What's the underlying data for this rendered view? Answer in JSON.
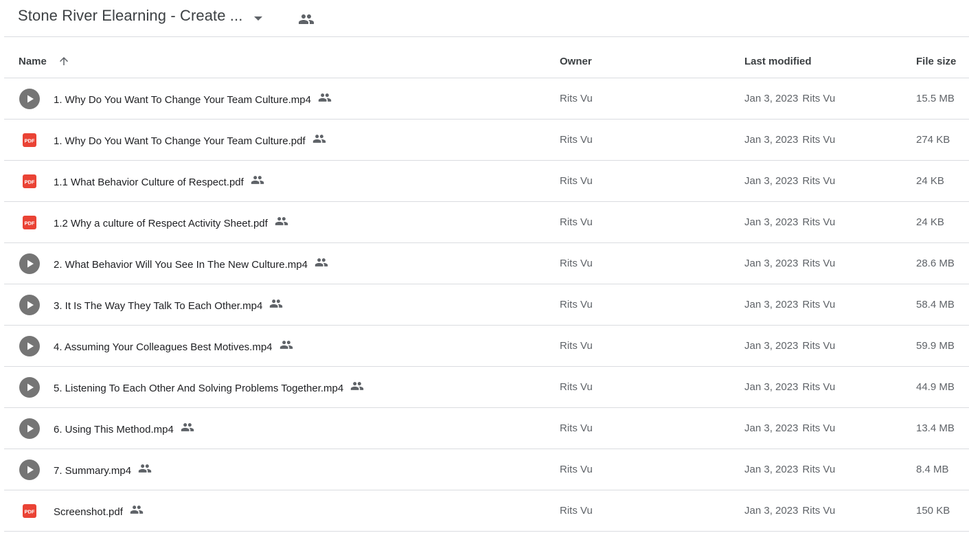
{
  "header": {
    "folder_title": "Stone River Elearning - Create ...",
    "caret_icon": "arrow-drop-down-icon",
    "shared_icon": "people-icon"
  },
  "columns": {
    "name": "Name",
    "owner": "Owner",
    "last_modified": "Last modified",
    "file_size": "File size",
    "sort_icon": "arrow-upward-icon"
  },
  "colors": {
    "pdf_red": "#ea4335",
    "video_gray": "#757575",
    "divider": "#dadce0"
  },
  "files": [
    {
      "type": "video",
      "name": "1. Why Do You Want To Change Your Team Culture.mp4",
      "owner": "Rits Vu",
      "modified_date": "Jan 3, 2023",
      "modified_by": "Rits Vu",
      "size": "15.5 MB"
    },
    {
      "type": "pdf",
      "name": "1. Why Do You Want To Change Your Team Culture.pdf",
      "owner": "Rits Vu",
      "modified_date": "Jan 3, 2023",
      "modified_by": "Rits Vu",
      "size": "274 KB"
    },
    {
      "type": "pdf",
      "name": "1.1 What Behavior Culture of Respect.pdf",
      "owner": "Rits Vu",
      "modified_date": "Jan 3, 2023",
      "modified_by": "Rits Vu",
      "size": "24 KB"
    },
    {
      "type": "pdf",
      "name": "1.2 Why a culture of Respect Activity Sheet.pdf",
      "owner": "Rits Vu",
      "modified_date": "Jan 3, 2023",
      "modified_by": "Rits Vu",
      "size": "24 KB"
    },
    {
      "type": "video",
      "name": "2. What Behavior Will You See In The New Culture.mp4",
      "owner": "Rits Vu",
      "modified_date": "Jan 3, 2023",
      "modified_by": "Rits Vu",
      "size": "28.6 MB"
    },
    {
      "type": "video",
      "name": "3. It Is The Way They Talk To Each Other.mp4",
      "owner": "Rits Vu",
      "modified_date": "Jan 3, 2023",
      "modified_by": "Rits Vu",
      "size": "58.4 MB"
    },
    {
      "type": "video",
      "name": "4. Assuming Your Colleagues Best Motives.mp4",
      "owner": "Rits Vu",
      "modified_date": "Jan 3, 2023",
      "modified_by": "Rits Vu",
      "size": "59.9 MB"
    },
    {
      "type": "video",
      "name": "5. Listening To Each Other And Solving Problems Together.mp4",
      "owner": "Rits Vu",
      "modified_date": "Jan 3, 2023",
      "modified_by": "Rits Vu",
      "size": "44.9 MB"
    },
    {
      "type": "video",
      "name": "6. Using This Method.mp4",
      "owner": "Rits Vu",
      "modified_date": "Jan 3, 2023",
      "modified_by": "Rits Vu",
      "size": "13.4 MB"
    },
    {
      "type": "video",
      "name": "7. Summary.mp4",
      "owner": "Rits Vu",
      "modified_date": "Jan 3, 2023",
      "modified_by": "Rits Vu",
      "size": "8.4 MB"
    },
    {
      "type": "pdf",
      "name": "Screenshot.pdf",
      "owner": "Rits Vu",
      "modified_date": "Jan 3, 2023",
      "modified_by": "Rits Vu",
      "size": "150 KB"
    }
  ],
  "icons": {
    "video": "video-play-icon",
    "pdf": "pdf-icon",
    "shared": "people-icon",
    "pdf_label": "PDF"
  }
}
